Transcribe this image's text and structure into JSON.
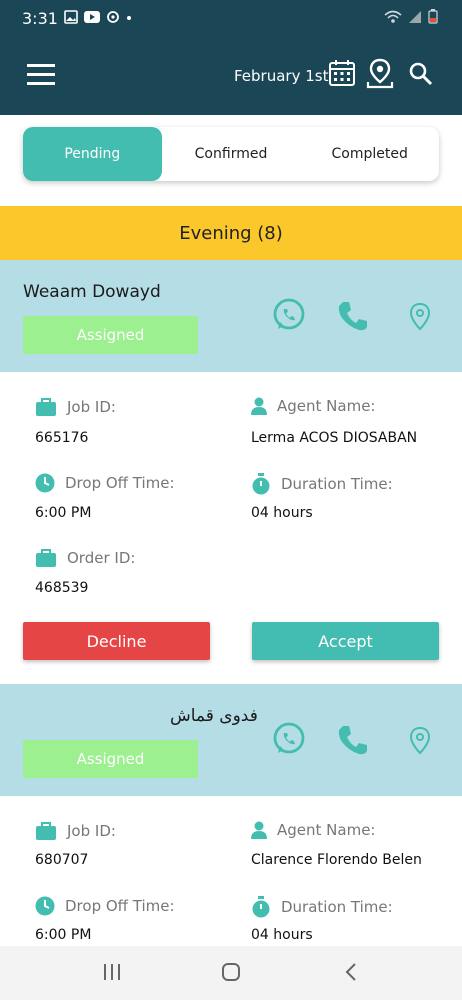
{
  "status_bar": {
    "time": "3:31"
  },
  "app_bar": {
    "date": "February 1st"
  },
  "tabs": [
    {
      "label": "Pending",
      "active": true
    },
    {
      "label": "Confirmed",
      "active": false
    },
    {
      "label": "Completed",
      "active": false
    }
  ],
  "section": {
    "title": "Evening (8)"
  },
  "labels": {
    "job_id": "Job ID:",
    "agent_name": "Agent Name:",
    "drop_off_time": "Drop Off Time:",
    "duration_time": "Duration Time:",
    "order_id": "Order ID:",
    "decline": "Decline",
    "accept": "Accept"
  },
  "jobs": [
    {
      "customer": "Weaam Dowayd",
      "status": "Assigned",
      "job_id": "665176",
      "agent_name": "Lerma ACOS DIOSABAN",
      "drop_off_time": "6:00 PM",
      "duration_time": "04 hours",
      "order_id": "468539"
    },
    {
      "customer": "فدوى قماش",
      "status": "Assigned",
      "job_id": "680707",
      "agent_name": "Clarence Florendo Belen",
      "drop_off_time": "6:00 PM",
      "duration_time": "04 hours"
    }
  ],
  "colors": {
    "header": "#1a4656",
    "accent": "#44bdb1",
    "section": "#fbc72a",
    "card_header": "#b4dde6",
    "badge": "#9cf08f",
    "decline": "#e64545"
  }
}
